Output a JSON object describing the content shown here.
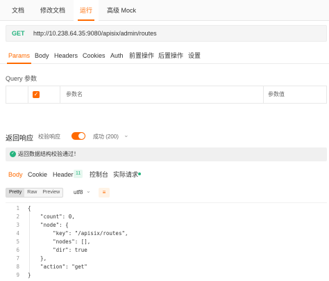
{
  "top_tabs": [
    "文档",
    "修改文档",
    "运行",
    "高级 Mock"
  ],
  "request": {
    "method": "GET",
    "url": "http://10.238.64.35:9080/apisix/admin/routes"
  },
  "request_tabs": [
    "Params",
    "Body",
    "Headers",
    "Cookies",
    "Auth",
    "前置操作",
    "后置操作",
    "设置"
  ],
  "query": {
    "label": "Query 参数",
    "columns": [
      "参数名",
      "参数值"
    ],
    "checkbox_glyph": "✓"
  },
  "response": {
    "title": "返回响应",
    "validate_label": "校验响应",
    "status_text": "成功 (200)",
    "chevron": "⌄",
    "validation_message": "返回数据结构校验通过！",
    "validation_icon": "check-circle-icon"
  },
  "body_tabs": [
    "Body",
    "Cookie",
    "Header",
    "控制台",
    "实际请求"
  ],
  "header_count": "11",
  "view_modes": [
    "Pretty",
    "Raw",
    "Preview"
  ],
  "encoding": "utf8",
  "wrap_icon": "≡",
  "code_lines": [
    {
      "n": "1",
      "text": "{"
    },
    {
      "n": "2",
      "text": "    \"count\": 0,"
    },
    {
      "n": "3",
      "text": "    \"node\": {"
    },
    {
      "n": "4",
      "text": "        \"key\": \"/apisix/routes\","
    },
    {
      "n": "5",
      "text": "        \"nodes\": [],"
    },
    {
      "n": "6",
      "text": "        \"dir\": true"
    },
    {
      "n": "7",
      "text": "    },"
    },
    {
      "n": "8",
      "text": "    \"action\": \"get\""
    },
    {
      "n": "9",
      "text": "}"
    }
  ],
  "colors": {
    "accent": "#ff6a00",
    "method": "#26b47f",
    "success": "#26b47f"
  }
}
